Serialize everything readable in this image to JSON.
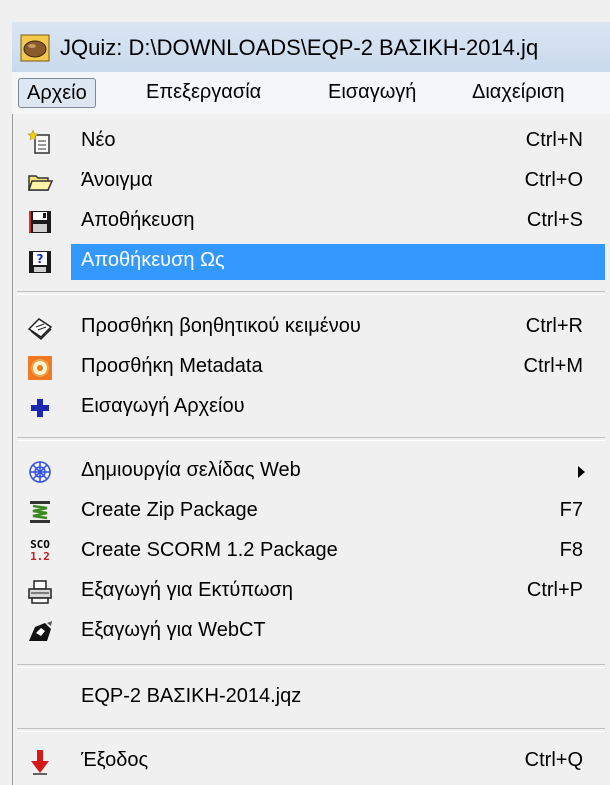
{
  "window": {
    "title": "JQuiz: D:\\DOWNLOADS\\EQP-2 ΒΑΣΙΚΗ-2014.jq"
  },
  "menubar": {
    "items": [
      {
        "label": "Αρχείο"
      },
      {
        "label": "Επεξεργασία"
      },
      {
        "label": "Εισαγωγή"
      },
      {
        "label": "Διαχείριση"
      }
    ]
  },
  "file_menu": {
    "items": [
      {
        "label": "Νέο",
        "shortcut": "Ctrl+N",
        "icon": "new-file-icon"
      },
      {
        "label": "Άνοιγμα",
        "shortcut": "Ctrl+O",
        "icon": "open-folder-icon"
      },
      {
        "label": "Αποθήκευση",
        "shortcut": "Ctrl+S",
        "icon": "save-disk-icon"
      },
      {
        "label": "Αποθήκευση Ως",
        "shortcut": "",
        "icon": "save-as-icon",
        "highlighted": true
      },
      {
        "label": "Προσθήκη βοηθητικού κειμένου",
        "shortcut": "Ctrl+R",
        "icon": "reading-text-icon"
      },
      {
        "label": "Προσθήκη Metadata",
        "shortcut": "Ctrl+M",
        "icon": "metadata-icon"
      },
      {
        "label": "Εισαγωγή Αρχείου",
        "shortcut": "",
        "icon": "plus-icon"
      },
      {
        "label": "Δημιουργία σελίδας Web",
        "shortcut": "",
        "icon": "web-page-icon",
        "submenu": true
      },
      {
        "label": "Create Zip Package",
        "shortcut": "F7",
        "icon": "zip-icon"
      },
      {
        "label": "Create SCORM 1.2 Package",
        "shortcut": "F8",
        "icon": "scorm-icon",
        "icon_text_top": "SCO",
        "icon_text_bottom": "1.2"
      },
      {
        "label": "Εξαγωγή για Εκτύπωση",
        "shortcut": "Ctrl+P",
        "icon": "printer-icon"
      },
      {
        "label": "Εξαγωγή για WebCT",
        "shortcut": "",
        "icon": "webct-icon"
      },
      {
        "label": "EQP-2 ΒΑΣΙΚΗ-2014.jqz",
        "shortcut": "",
        "icon": ""
      },
      {
        "label": "Έξοδος",
        "shortcut": "Ctrl+Q",
        "icon": "exit-arrow-icon"
      }
    ]
  },
  "colors": {
    "highlight": "#3399ff",
    "menu_bg": "#f0f0f0"
  }
}
